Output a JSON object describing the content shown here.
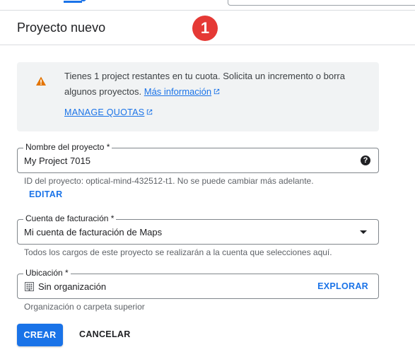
{
  "header": {
    "title": "Proyecto nuevo",
    "step_badge": "1"
  },
  "quota_notice": {
    "icon": "warning-icon",
    "message": "Tienes 1 project restantes en tu cuota. Solicita un incremento o borra algunos proyectos.",
    "more_info_link": "Más información",
    "manage_quotas_link": "MANAGE QUOTAS"
  },
  "project_name": {
    "label": "Nombre del proyecto *",
    "value": "My Project 7015",
    "help_icon": "help-icon",
    "id_hint": "ID del proyecto: optical-mind-432512-t1. No se puede cambiar más adelante.",
    "edit_label": "EDITAR"
  },
  "billing_account": {
    "label": "Cuenta de facturación *",
    "value": "Mi cuenta de facturación de Maps",
    "hint": "Todos los cargos de este proyecto se realizarán a la cuenta que selecciones aquí."
  },
  "location": {
    "label": "Ubicación *",
    "value": "Sin organización",
    "browse_label": "EXPLORAR",
    "hint": "Organización o carpeta superior"
  },
  "actions": {
    "create_label": "CREAR",
    "cancel_label": "CANCELAR"
  },
  "colors": {
    "accent": "#1a73e8",
    "warning": "#e37400",
    "badge": "#e53935"
  }
}
